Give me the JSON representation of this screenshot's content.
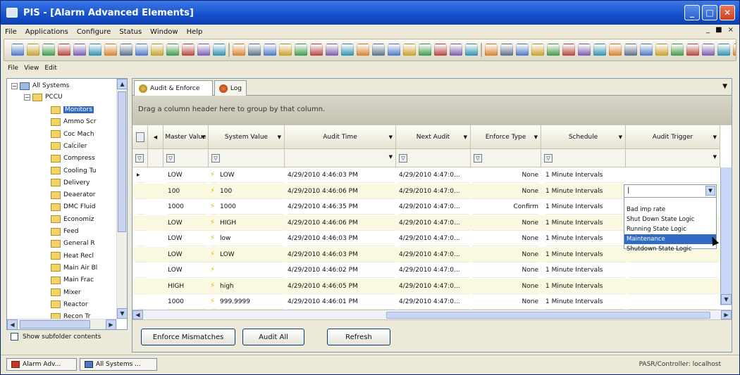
{
  "window": {
    "title": "PIS - [Alarm Advanced Elements]",
    "min_label": "_",
    "max_label": "□",
    "close_label": "✕"
  },
  "menu": {
    "items": [
      "File",
      "Applications",
      "Configure",
      "Status",
      "Window",
      "Help"
    ],
    "mdi_min": "_",
    "mdi_restore": "■",
    "mdi_close": "×"
  },
  "toolbar": {
    "button_count": 48,
    "colors": [
      "#4a78c8",
      "#c9a227",
      "#3f9a4a",
      "#b8423a",
      "#7a5cae",
      "#2f8fb0",
      "#d9822b",
      "#5a6f88"
    ]
  },
  "submenu": {
    "items": [
      "File",
      "View",
      "Edit"
    ]
  },
  "tree": {
    "root": "All Systems",
    "child": "PCCU",
    "items": [
      "Monitors",
      "Ammo Scr",
      "Coc Mach",
      "Calciler",
      "Compress",
      "Cooling Tu",
      "Delivery",
      "Deaerator",
      "DMC Fluid",
      "Economiz",
      "Feed",
      "General R",
      "Heat Recl",
      "Main Air Bl",
      "Main Frac",
      "Mixer",
      "Reactor",
      "Recon Tr"
    ],
    "selected_index": 0,
    "show_sub_label": "Show subfolder contents"
  },
  "tabs": [
    {
      "label": "Audit & Enforce",
      "active": true
    },
    {
      "label": "Log",
      "active": false
    }
  ],
  "grid": {
    "group_hint": "Drag a column header here to group by that column.",
    "columns": [
      "Master Value",
      "System Value",
      "Audit Time",
      "Next Audit",
      "Enforce Type",
      "Schedule",
      "Audit Trigger"
    ],
    "rows": [
      {
        "master": "LOW",
        "system": "LOW",
        "audit_time": "4/29/2010 4:46:03 PM",
        "next_audit": "4/29/2010 4:47:0...",
        "enforce": "None",
        "schedule": "1 Minute Intervals",
        "trigger": ""
      },
      {
        "master": "100",
        "system": "100",
        "audit_time": "4/29/2010 4:46:06 PM",
        "next_audit": "4/29/2010 4:47:0...",
        "enforce": "None",
        "schedule": "1 Minute Intervals",
        "trigger": ""
      },
      {
        "master": "1000",
        "system": "1000",
        "audit_time": "4/29/2010 4:46:35 PM",
        "next_audit": "4/29/2010 4:47:0...",
        "enforce": "Confirm",
        "schedule": "1 Minute Intervals",
        "trigger": ""
      },
      {
        "master": "LOW",
        "system": "HIGH",
        "audit_time": "4/29/2010 4:46:06 PM",
        "next_audit": "4/29/2010 4:47:0...",
        "enforce": "None",
        "schedule": "1 Minute Intervals",
        "trigger": ""
      },
      {
        "master": "LOW",
        "system": "low",
        "audit_time": "4/29/2010 4:46:03 PM",
        "next_audit": "4/29/2010 4:47:0...",
        "enforce": "None",
        "schedule": "1 Minute Intervals",
        "trigger": ""
      },
      {
        "master": "LOW",
        "system": "LOW",
        "audit_time": "4/29/2010 4:46:03 PM",
        "next_audit": "4/29/2010 4:47:0...",
        "enforce": "None",
        "schedule": "1 Minute Intervals",
        "trigger": ""
      },
      {
        "master": "LOW",
        "system": "",
        "audit_time": "4/29/2010 4:46:02 PM",
        "next_audit": "4/29/2010 4:47:0...",
        "enforce": "None",
        "schedule": "1 Minute Intervals",
        "trigger": ""
      },
      {
        "master": "HIGH",
        "system": "high",
        "audit_time": "4/29/2010 4:46:05 PM",
        "next_audit": "4/29/2010 4:47:0...",
        "enforce": "None",
        "schedule": "1 Minute Intervals",
        "trigger": ""
      },
      {
        "master": "1000",
        "system": "999.9999",
        "audit_time": "4/29/2010 4:46:01 PM",
        "next_audit": "4/29/2010 4:47:0...",
        "enforce": "None",
        "schedule": "1 Minute Intervals",
        "trigger": ""
      }
    ],
    "dropdown_options": [
      "Bad imp rate",
      "Shut Down State Logic",
      "Running State Logic",
      "Maintenance",
      "Shutdown State Logic"
    ],
    "dropdown_highlight": 3
  },
  "buttons": {
    "enforce_mismatches": "Enforce Mismatches",
    "audit_all": "Audit All",
    "refresh": "Refresh"
  },
  "statusbar": {
    "tasks": [
      "Alarm Adv...",
      "All Systems ..."
    ],
    "text": "PASR/Controller: localhost"
  }
}
